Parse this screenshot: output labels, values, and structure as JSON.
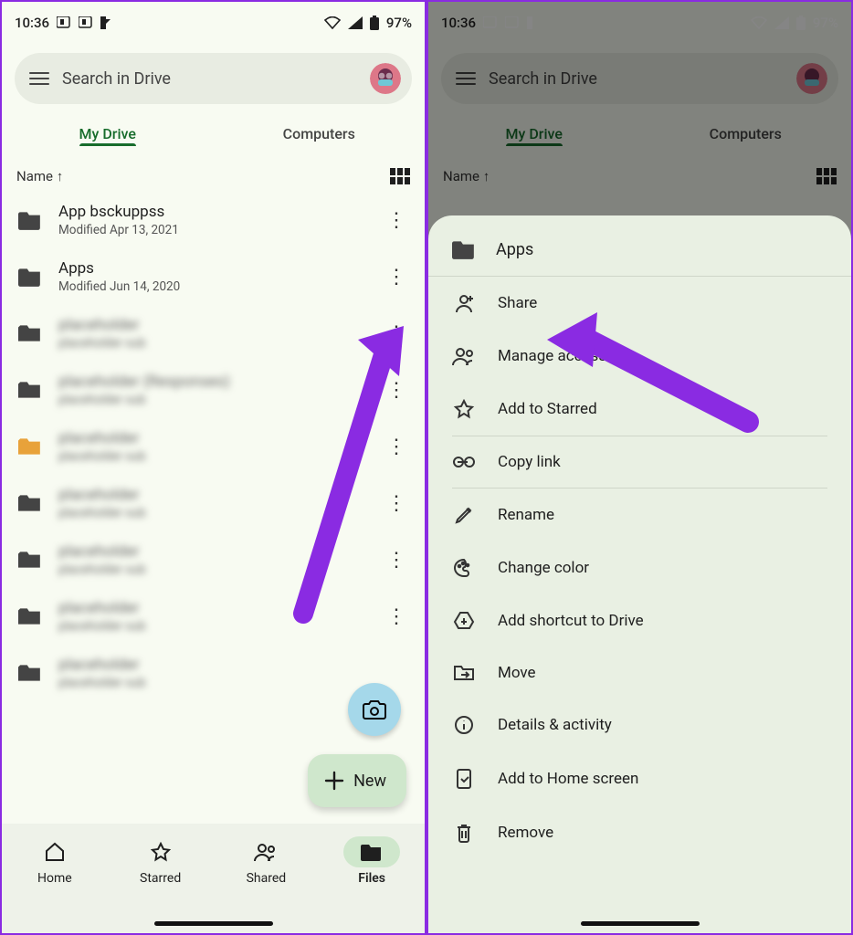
{
  "status": {
    "time": "10:36",
    "battery": "97%"
  },
  "search": {
    "placeholder": "Search in Drive"
  },
  "tabs": {
    "active": "My Drive",
    "other": "Computers"
  },
  "sort": {
    "label": "Name"
  },
  "files": {
    "items": [
      {
        "name": "App bsckuppss",
        "sub": "Modified Apr 13, 2021"
      },
      {
        "name": "Apps",
        "sub": "Modified Jun 14, 2020"
      },
      {
        "name": "placeholder",
        "sub": "placeholder sub"
      },
      {
        "name": "placeholder (Responses)",
        "sub": "placeholder sub"
      },
      {
        "name": "placeholder",
        "sub": "placeholder sub"
      },
      {
        "name": "placeholder",
        "sub": "placeholder sub"
      },
      {
        "name": "placeholder",
        "sub": "placeholder sub"
      },
      {
        "name": "placeholder",
        "sub": "placeholder sub"
      },
      {
        "name": "placeholder",
        "sub": "placeholder sub"
      }
    ]
  },
  "fab": {
    "new_label": "New"
  },
  "bottom_nav": {
    "home": "Home",
    "starred": "Starred",
    "shared": "Shared",
    "files": "Files"
  },
  "sheet": {
    "title": "Apps",
    "share": "Share",
    "manage": "Manage access",
    "star": "Add to Starred",
    "copy": "Copy link",
    "rename": "Rename",
    "color": "Change color",
    "shortcut": "Add shortcut to Drive",
    "move": "Move",
    "details": "Details & activity",
    "homescreen": "Add to Home screen",
    "remove": "Remove"
  },
  "colors": {
    "arrow": "#8a2be2"
  }
}
